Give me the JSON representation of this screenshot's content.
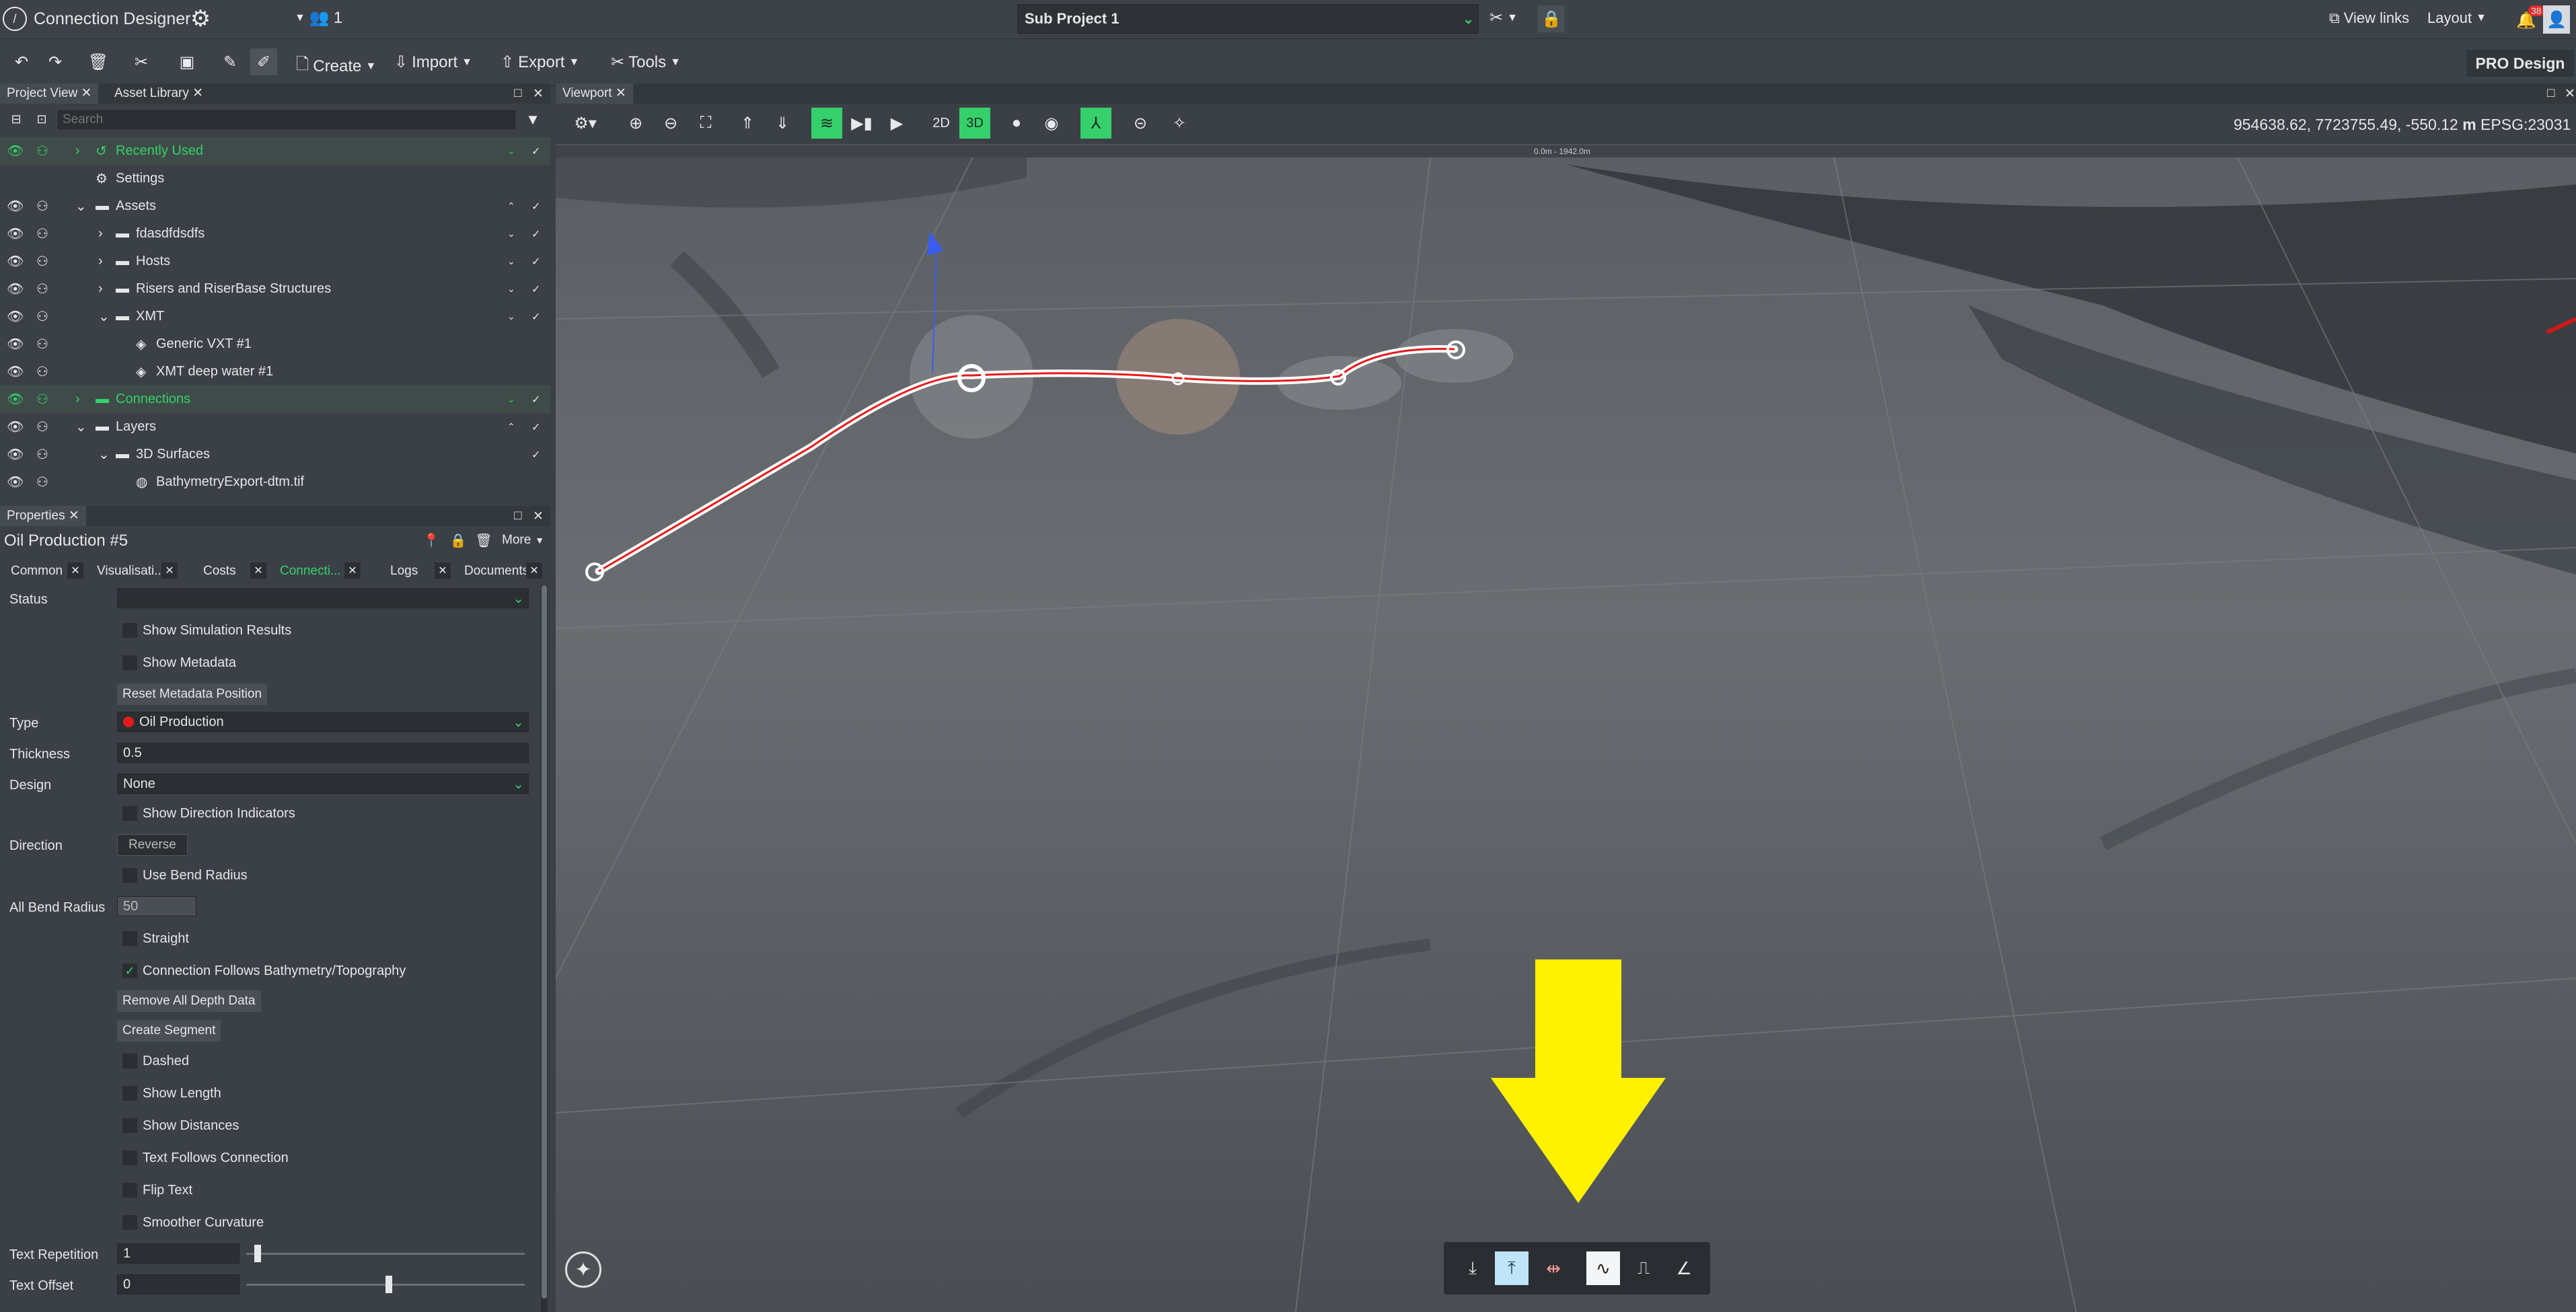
{
  "app": {
    "title": "Connection Designer",
    "users_count": "1",
    "project": "Sub Project 1",
    "view_links": "View links",
    "layout": "Layout",
    "notif_count": "38",
    "pro": "PRO Design"
  },
  "toolbar": {
    "create": "Create",
    "import": "Import",
    "export": "Export",
    "tools": "Tools"
  },
  "project_view": {
    "tab1": "Project View",
    "tab2": "Asset Library",
    "search_placeholder": "Search",
    "items": [
      "Recently Used",
      "Settings",
      "Assets",
      "fdasdfdsdfs",
      "Hosts",
      "Risers and RiserBase Structures",
      "XMT",
      "Generic VXT #1",
      "XMT deep water #1",
      "Connections",
      "Layers",
      "3D Surfaces",
      "BathymetryExport-dtm.tif"
    ]
  },
  "properties": {
    "tab": "Properties",
    "title": "Oil Production #5",
    "more": "More",
    "tabs": [
      "Common",
      "Visualisati...",
      "Costs",
      "Connecti...",
      "Logs",
      "Documents"
    ],
    "status_label": "Status",
    "status_value": "",
    "show_sim": "Show Simulation Results",
    "show_meta": "Show Metadata",
    "reset_meta": "Reset Metadata Position",
    "type_label": "Type",
    "type_value": "Oil Production",
    "thickness_label": "Thickness",
    "thickness_value": "0.5",
    "design_label": "Design",
    "design_value": "None",
    "show_dir": "Show Direction Indicators",
    "direction_label": "Direction",
    "reverse": "Reverse",
    "use_bend": "Use Bend Radius",
    "bend_label": "All Bend Radius",
    "bend_value": "50",
    "straight": "Straight",
    "follows": "Connection Follows Bathymetry/Topography",
    "remove_depth": "Remove All Depth Data",
    "create_segment": "Create Segment",
    "dashed": "Dashed",
    "show_length": "Show Length",
    "show_dist": "Show Distances",
    "text_follows": "Text Follows Connection",
    "flip_text": "Flip Text",
    "smoother": "Smoother Curvature",
    "text_rep_label": "Text Repetition",
    "text_rep_value": "1",
    "text_rep_fraction": 0.03,
    "text_off_label": "Text Offset",
    "text_off_value": "0",
    "text_off_fraction": 0.5
  },
  "viewport": {
    "tab": "Viewport",
    "coords": "954638.62, 7723755.49, -550.12",
    "unit": "m",
    "epsg": "EPSG:23031",
    "scale": "0.0m - 1942.0m",
    "mode2d": "2D",
    "mode3d": "3D"
  },
  "colors": {
    "accent": "#35d06b",
    "oil": "#e41b1b",
    "arrow": "#fff200"
  }
}
